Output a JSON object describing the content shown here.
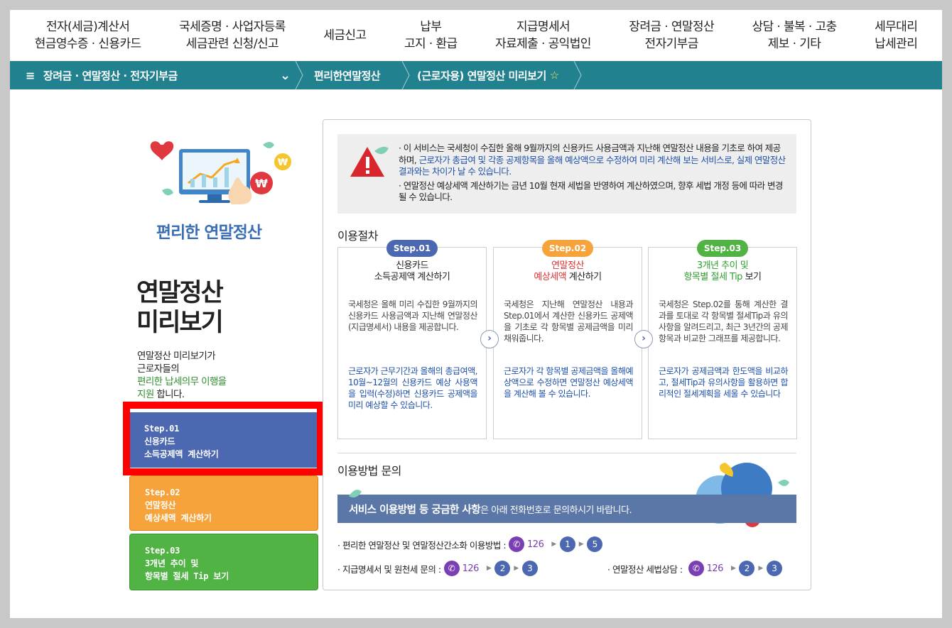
{
  "top_nav": [
    {
      "line1": "전자(세금)계산서",
      "line2": "현금영수증 · 신용카드"
    },
    {
      "line1": "국세증명 · 사업자등록",
      "line2": "세금관련 신청/신고"
    },
    {
      "line1": "세금신고",
      "line2": ""
    },
    {
      "line1": "납부",
      "line2": "고지 · 환급"
    },
    {
      "line1": "지급명세서",
      "line2": "자료제출 · 공익법인"
    },
    {
      "line1": "장려금 · 연말정산",
      "line2": "전자기부금"
    },
    {
      "line1": "상담 · 불복 · 고충",
      "line2": "제보 · 기타"
    },
    {
      "line1": "세무대리",
      "line2": "납세관리"
    }
  ],
  "breadcrumb": {
    "menu_icon": "≡",
    "section": "장려금 · 연말정산 · 전자기부금",
    "dropdown_icon": "⌄",
    "sub": "편리한연말정산",
    "page": "(근로자용) 연말정산 미리보기",
    "star_icon": "☆"
  },
  "sidebar": {
    "promo_title": "편리한 연말정산",
    "title_line1": "연말정산",
    "title_line2": "미리보기",
    "desc_line1": "연말정산 미리보기가",
    "desc_line2": "근로자들의",
    "desc_green1": "편리한 납세의무 이행을",
    "desc_green2": "지원",
    "desc_end": " 합니다.",
    "steps": [
      {
        "line1": "Step.01",
        "line2": "신용카드",
        "line3": "소득공제액 계산하기"
      },
      {
        "line1": "Step.02",
        "line2": "연말정산",
        "line3": "예상세액 계산하기"
      },
      {
        "line1": "Step.03",
        "line2": "3개년 추이 및",
        "line3": "항목별 절세 Tip 보기"
      }
    ]
  },
  "notice": {
    "p1_a": "· 이 서비스는 국세청이 수집한 올해 9월까지의 신용카드 사용금액과 지난해 연말정산 내용을 기초로 하여 제공하며, ",
    "p1_b": "근로자가 총급여 및 각종 공제항목을 올해 예상액으로 수정하여 미리 계산해 보는 서비스로, 실제 연말정산 결과와는 차이가 날 수 있습니다.",
    "p2": "· 연말정산 예상세액 계산하기는 금년 10월 현재 세법을 반영하여 계산하였으며, 향후 세법 개정 등에 따라 변경될 수 있습니다."
  },
  "procedure": {
    "title": "이용절차",
    "steps": [
      {
        "badge": "Step.01",
        "badge_color": "#4c68b0",
        "head1": "신용카드",
        "head2": "소득공제액 계산하기",
        "body": "국세청은 올해 미리 수집한 9월까지의 신용카드 사용금액과 지난해 연말정산(지급명세서) 내용을 제공합니다.",
        "note": "근로자가 근무기간과 올해의 총급여액, 10월~12월의 신용카드 예상 사용액을 입력(수정)하면 신용카드 공제액을 미리 예상할 수 있습니다."
      },
      {
        "badge": "Step.02",
        "badge_color": "#f7a33c",
        "head1": "연말정산",
        "head2a": "예상세액",
        "head2b": " 계산하기",
        "body": "국세청은 지난해 연말정산 내용과 Step.01에서 계산한 신용카드 공제액을 기초로 각 항목별 공제금액을 미리 채워줍니다.",
        "note": "근로자가 각 항목별 공제금액을 올해예상액으로 수정하면 연말정산 예상세액을 계산해 볼 수 있습니다."
      },
      {
        "badge": "Step.03",
        "badge_color": "#50b343",
        "head1": "3개년 추이 및",
        "head2a": "항목별 절세 Tip",
        "head2b": " 보기",
        "body": "국세청은 Step.02를 통해 계산한 결과를 토대로 각 항목별 절세Tip과 유의사항을 알려드리고, 최근 3년간의 공제항목과 비교한 그래프를 제공합니다.",
        "note": "근로자가 공제금액과 한도액을 비교하고, 절세Tip과 유의사항을 활용하면 합리적인 절세계획을 세울 수 있습니다"
      }
    ],
    "arrow_icon": "›"
  },
  "inquiry": {
    "title": "이용방법 문의",
    "banner_bold": "서비스 이용방법 등 궁금한 사항",
    "banner_rest": "은 아래 전화번호로 문의하시기 바랍니다.",
    "rows": [
      {
        "label": "· 편리한 연말정산 및 연말정산간소화 이용방법 :",
        "number": "126",
        "steps": [
          "1",
          "5"
        ]
      },
      {
        "label": "· 지급명세서  및 원천세 문의 :",
        "number": "126",
        "steps": [
          "2",
          "3"
        ]
      },
      {
        "label": "· 연말정산  세법상담  :",
        "number": "126",
        "steps": [
          "2",
          "3"
        ]
      }
    ]
  },
  "colors": {
    "teal_bar": "#22818f",
    "step1_blue": "#4c68b0",
    "step2_orange": "#f7a33c",
    "step3_green": "#50b343",
    "highlight_red": "#ff0000"
  }
}
